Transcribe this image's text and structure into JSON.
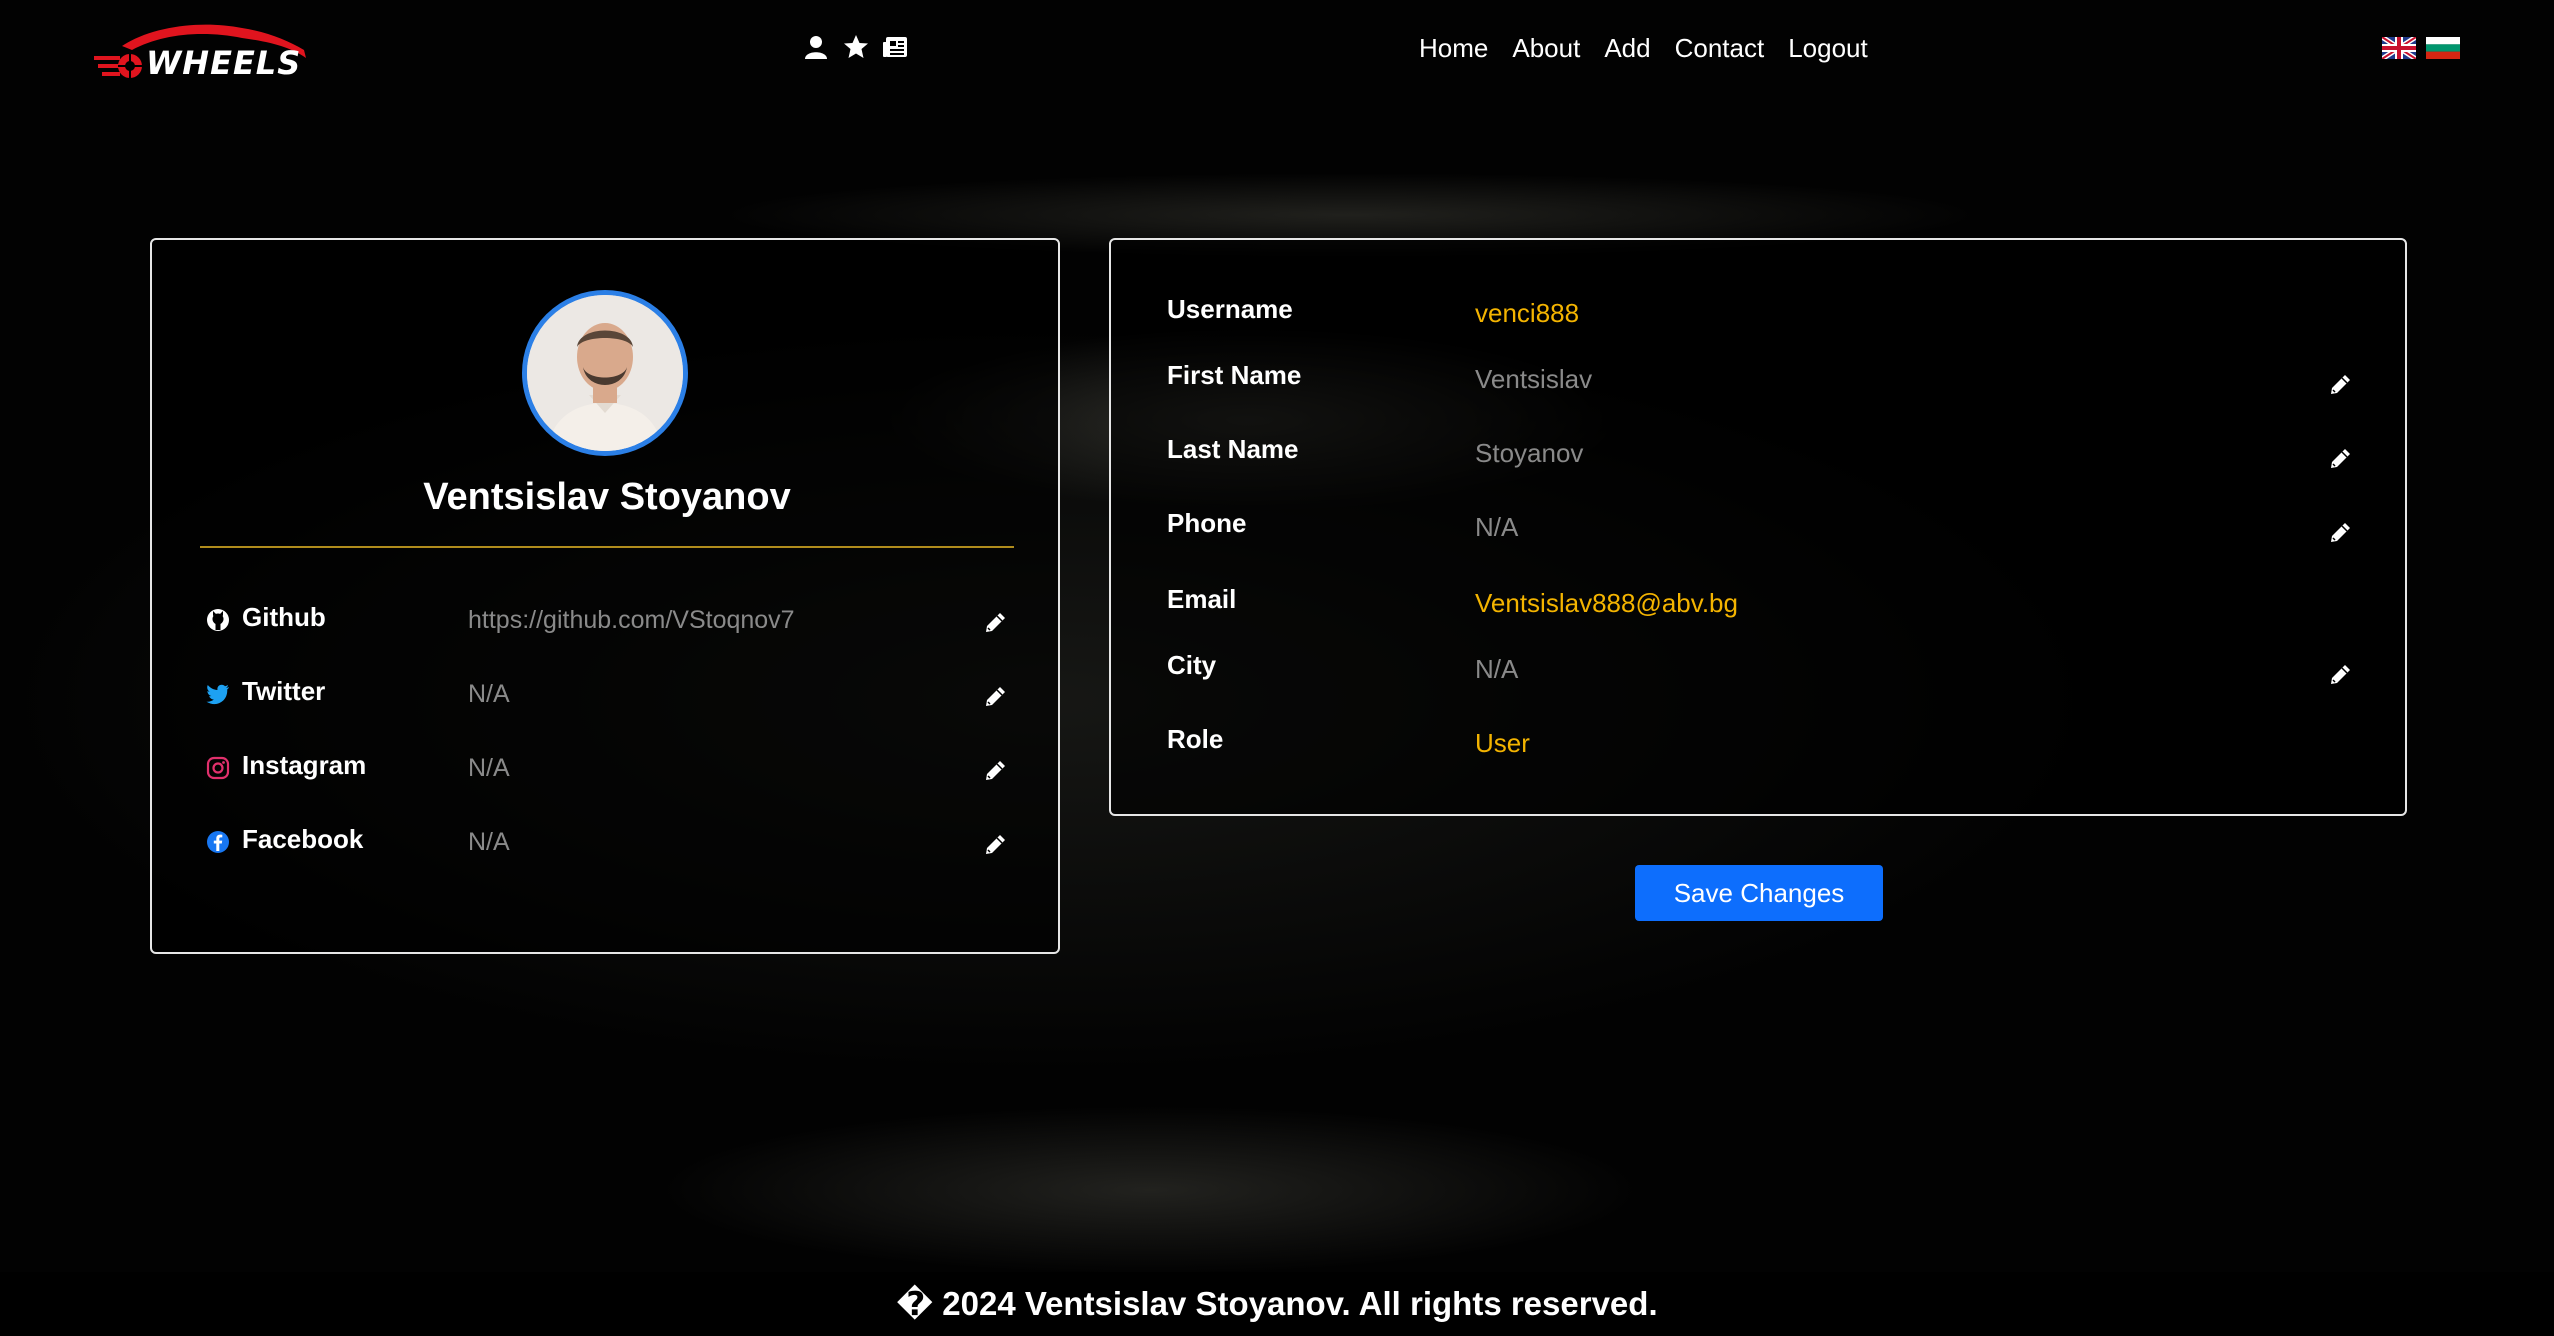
{
  "brand": {
    "logo_text": "WHEELS",
    "accent": "#e0141e"
  },
  "header": {
    "icons": [
      "user-icon",
      "star-icon",
      "newspaper-icon"
    ],
    "nav": [
      "Home",
      "About",
      "Add",
      "Contact",
      "Logout"
    ],
    "languages": [
      "English",
      "Bulgarian"
    ]
  },
  "profile": {
    "full_name": "Ventsislav Stoyanov",
    "avatar_border": "#2b7fe6",
    "social": [
      {
        "label": "Github",
        "value": "https://github.com/VStoqnov7",
        "icon": "github-icon"
      },
      {
        "label": "Twitter",
        "value": "N/A",
        "icon": "twitter-icon"
      },
      {
        "label": "Instagram",
        "value": "N/A",
        "icon": "instagram-icon"
      },
      {
        "label": "Facebook",
        "value": "N/A",
        "icon": "facebook-icon"
      }
    ]
  },
  "info": {
    "username": {
      "label": "Username",
      "value": "venci888"
    },
    "first_name": {
      "label": "First Name",
      "value": "Ventsislav"
    },
    "last_name": {
      "label": "Last Name",
      "value": "Stoyanov"
    },
    "phone": {
      "label": "Phone",
      "value": "N/A"
    },
    "email": {
      "label": "Email",
      "value": "Ventsislav888@abv.bg"
    },
    "city": {
      "label": "City",
      "value": "N/A"
    },
    "role": {
      "label": "Role",
      "value": "User"
    }
  },
  "actions": {
    "save_label": "Save Changes",
    "save_color": "#0d6efd"
  },
  "footer": {
    "text": "� 2024 Ventsislav Stoyanov. All rights reserved."
  },
  "colors": {
    "highlight": "#f4b400",
    "muted": "#8a8a8a"
  }
}
